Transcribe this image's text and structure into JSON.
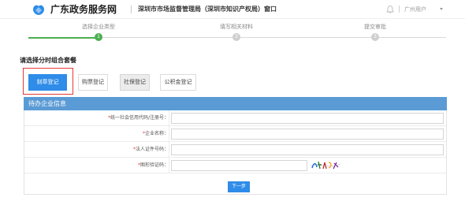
{
  "header": {
    "site_name": "广东政务服务网",
    "hall_name": "深圳市市场监督管理局（深圳市知识产权局）窗口",
    "user_name": "广州用户",
    "icons": {
      "logo": "gd-logo-icon",
      "notification": "bell-icon",
      "user_menu": "chevron-down-icon"
    },
    "colors": {
      "logo_blue": "#2f8ce8"
    }
  },
  "stepper": {
    "steps": [
      {
        "label": "选择企业类型",
        "number": "1"
      },
      {
        "label": "填写相关材料",
        "number": "2"
      },
      {
        "label": "提交审批",
        "number": "3"
      }
    ],
    "current_step": 1,
    "colors": {
      "active": "#4caf50",
      "inactive": "#cfcfcf"
    }
  },
  "section": {
    "title": "请选择分时组合套餐"
  },
  "options": {
    "items": [
      {
        "label": "刻章登记",
        "selected": true
      },
      {
        "label": "购票登记",
        "selected": false
      },
      {
        "label": "社保登记",
        "selected": false
      },
      {
        "label": "公积金登记",
        "selected": false
      }
    ],
    "colors": {
      "selected": "#2f8ce8",
      "highlight_border": "#e53935"
    }
  },
  "form": {
    "title": "待办企业信息",
    "fields": [
      {
        "label": "统一社会信用代码/注册号：",
        "value": "",
        "placeholder": ""
      },
      {
        "label": "企业名称：",
        "value": "",
        "placeholder": ""
      },
      {
        "label": "法人证件号码：",
        "value": "",
        "placeholder": ""
      },
      {
        "label": "图形验证码：",
        "value": "",
        "placeholder": ""
      }
    ],
    "required_mark": "*",
    "captcha_icon": "captcha-image",
    "next_label": "下一步",
    "colors": {
      "header_bg": "#5b9bd5",
      "required": "#e53935"
    }
  }
}
